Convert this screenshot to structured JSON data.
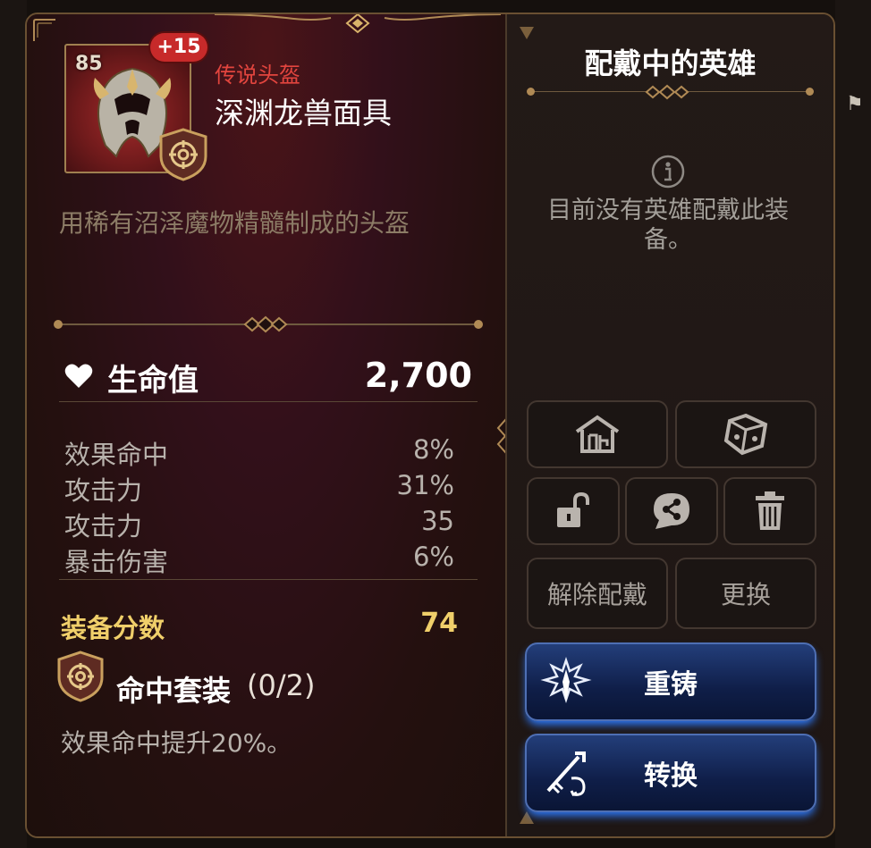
{
  "item": {
    "level": "85",
    "enhance": "+15",
    "rarity": "传说头盔",
    "name": "深渊龙兽面具",
    "description": "用稀有沼泽魔物精髓制成的头盔"
  },
  "main_stat": {
    "icon": "heart-icon",
    "label": "生命值",
    "value": "2,700"
  },
  "sub_stats": [
    {
      "label": "效果命中",
      "value": "8%"
    },
    {
      "label": "攻击力",
      "value": "31%"
    },
    {
      "label": "攻击力",
      "value": "35"
    },
    {
      "label": "暴击伤害",
      "value": "6%"
    }
  ],
  "gear_score": {
    "label": "装备分数",
    "value": "74"
  },
  "set": {
    "icon": "hit-set-icon",
    "name": "命中套装",
    "count": "(0/2)",
    "effect": "效果命中提升20%。"
  },
  "equipped": {
    "title": "配戴中的英雄",
    "empty_message": "目前没有英雄配戴此装备。"
  },
  "buttons": {
    "storage_icon": "storage-house-icon",
    "dice_icon": "dice-icon",
    "lock_icon": "unlock-icon",
    "share_icon": "share-icon",
    "delete_icon": "trash-icon",
    "unequip": "解除配戴",
    "change": "更换",
    "reforge": "重铸",
    "convert": "转换"
  },
  "colors": {
    "rarity": "#e2453e",
    "gear_score": "#f0cf6a",
    "accent_blue": "#2d7bff",
    "frame_gold": "#a08050"
  }
}
